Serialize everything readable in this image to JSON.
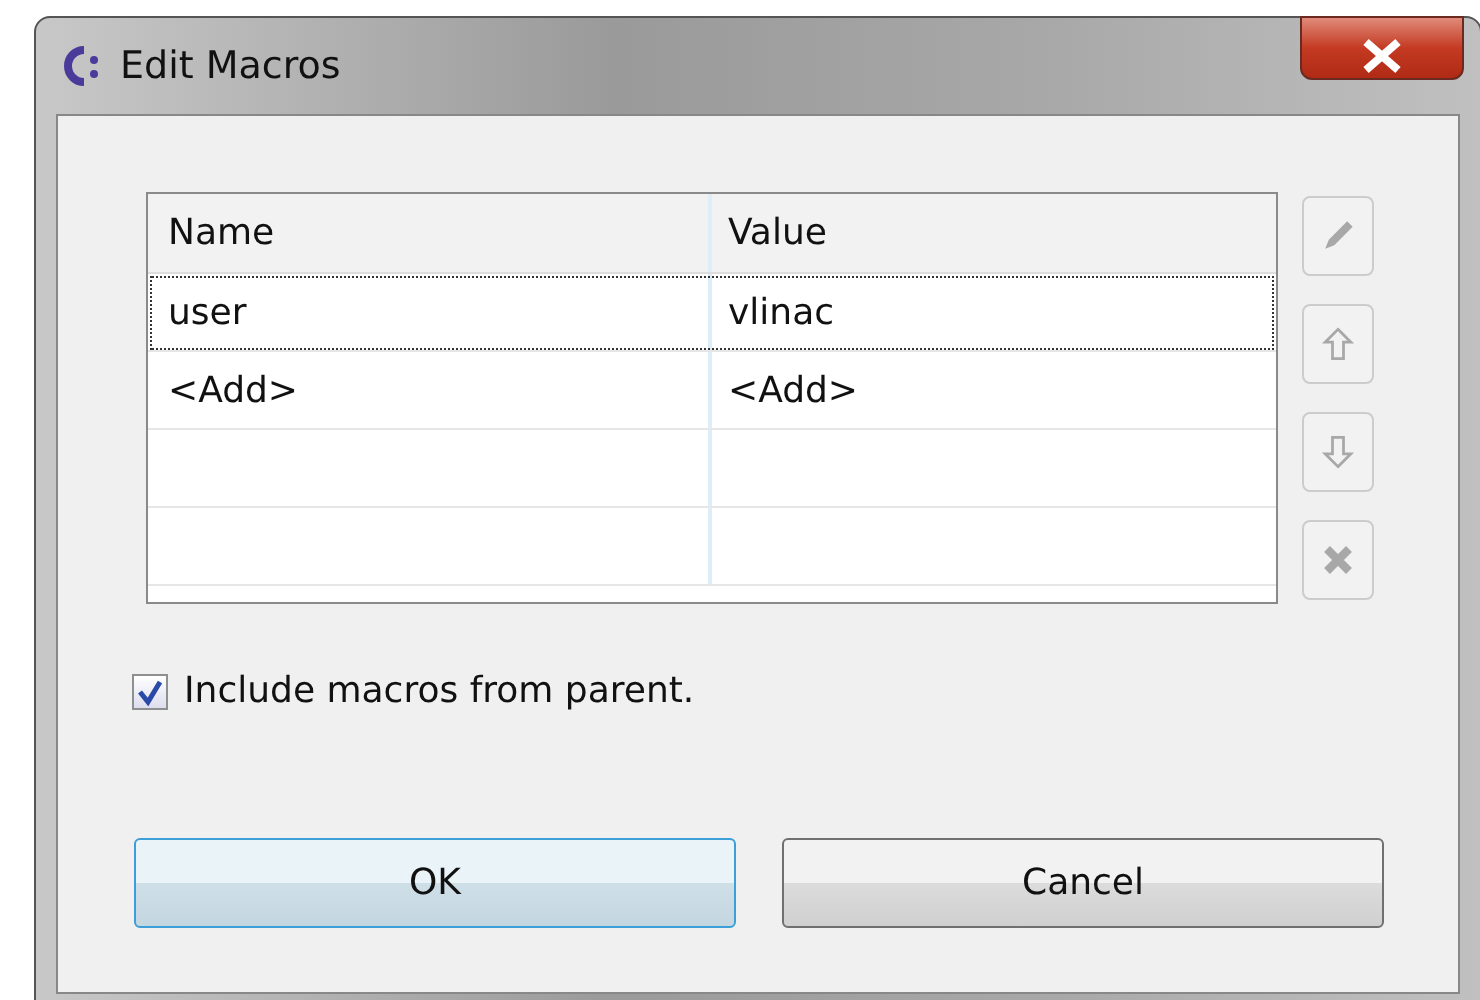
{
  "window": {
    "title": "Edit Macros"
  },
  "table": {
    "columns": [
      "Name",
      "Value"
    ],
    "rows": [
      {
        "cells": [
          "user",
          "vlinac"
        ],
        "focused": true
      },
      {
        "cells": [
          "<Add>",
          "<Add>"
        ],
        "focused": false
      },
      {
        "cells": [],
        "focused": false
      },
      {
        "cells": [],
        "focused": false
      }
    ]
  },
  "tools": [
    {
      "kind": "edit",
      "disabled": true
    },
    {
      "kind": "up",
      "disabled": true
    },
    {
      "kind": "down",
      "disabled": true
    },
    {
      "kind": "delete",
      "disabled": true
    }
  ],
  "include_parent": {
    "label": "Include macros from parent.",
    "checked": true
  },
  "buttons": [
    {
      "label": "OK",
      "default": true
    },
    {
      "label": "Cancel",
      "default": false
    }
  ]
}
